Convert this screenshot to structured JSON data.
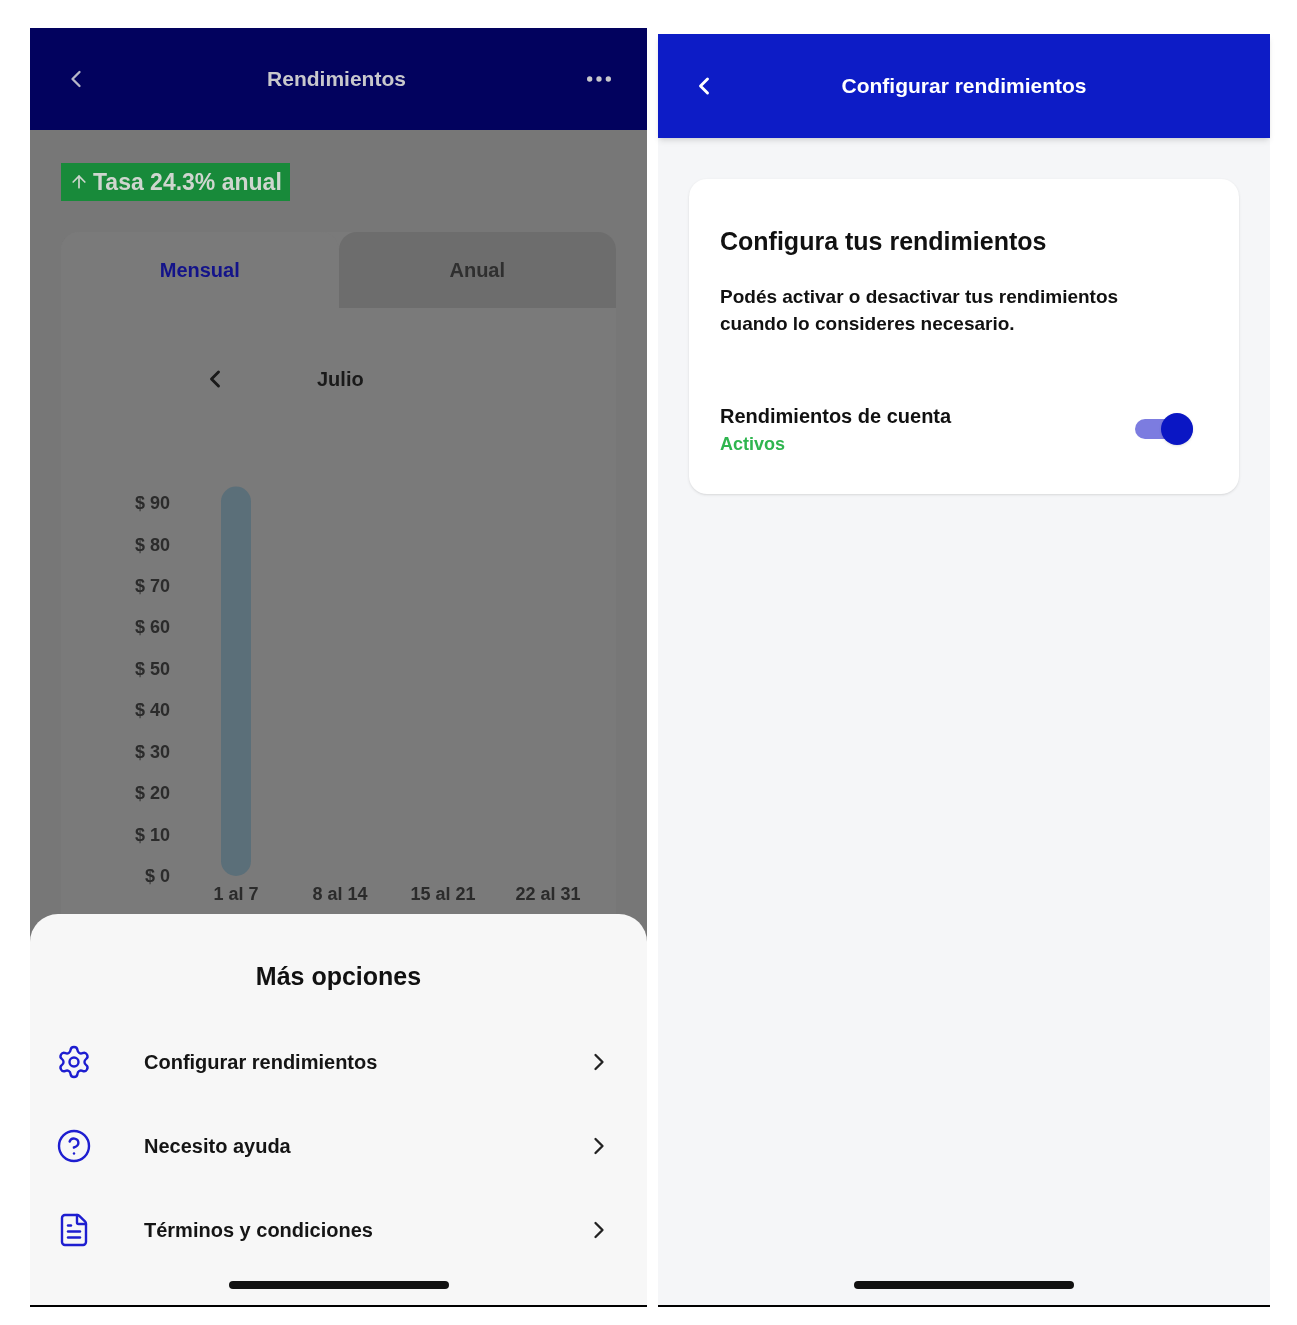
{
  "left_screen": {
    "header": {
      "title": "Rendimientos"
    },
    "rate_badge": "Tasa 24.3% anual",
    "tabs": [
      {
        "label": "Mensual",
        "selected": true
      },
      {
        "label": "Anual",
        "selected": false
      }
    ],
    "month": "Julio",
    "chart_data": {
      "type": "bar",
      "categories": [
        "1 al 7",
        "8 al 14",
        "15 al 21",
        "22 al 31"
      ],
      "values": [
        94,
        0,
        0,
        0
      ],
      "ylim": [
        0,
        94
      ],
      "yticks": [
        {
          "value": 0,
          "label": "$ 0"
        },
        {
          "value": 10,
          "label": "$ 10"
        },
        {
          "value": 20,
          "label": "$ 20"
        },
        {
          "value": 30,
          "label": "$ 30"
        },
        {
          "value": 40,
          "label": "$ 40"
        },
        {
          "value": 50,
          "label": "$ 50"
        },
        {
          "value": 60,
          "label": "$ 60"
        },
        {
          "value": 70,
          "label": "$ 70"
        },
        {
          "value": 80,
          "label": "$ 80"
        },
        {
          "value": 90,
          "label": "$ 90"
        }
      ]
    },
    "sheet": {
      "title": "Más opciones",
      "items": [
        {
          "kind": "settings",
          "label": "Configurar rendimientos"
        },
        {
          "kind": "help",
          "label": "Necesito ayuda"
        },
        {
          "kind": "document",
          "label": "Términos y condiciones"
        }
      ]
    }
  },
  "right_screen": {
    "header": {
      "title": "Configurar rendimientos"
    },
    "card": {
      "title": "Configura tus rendimientos",
      "description": "Podés activar o desactivar tus rendimientos cuando lo consideres necesario.",
      "setting": {
        "label": "Rendimientos de cuenta",
        "status": "Activos",
        "on": true
      }
    }
  }
}
